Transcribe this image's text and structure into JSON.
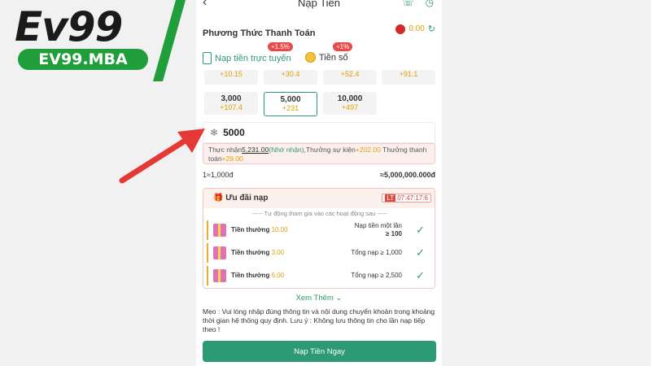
{
  "watermark": {
    "main": "Ev99",
    "sub": "EV99.MBA"
  },
  "header": {
    "title": "Nạp Tiền",
    "back_icon": "chevron-left-icon"
  },
  "payment": {
    "label": "Phương Thức Thanh Toán",
    "balance": "0.00"
  },
  "tabs": [
    {
      "label": "Nạp tiền trực tuyến",
      "badge": "+1.5%"
    },
    {
      "label": "Tiền số",
      "badge": "+1%"
    }
  ],
  "amounts": [
    {
      "value": "",
      "bonus": "+10.15"
    },
    {
      "value": "",
      "bonus": "+30.4"
    },
    {
      "value": "",
      "bonus": "+52.4"
    },
    {
      "value": "",
      "bonus": "+91.1"
    },
    {
      "value": "3,000",
      "bonus": "+107.4"
    },
    {
      "value": "5,000",
      "bonus": "+231"
    },
    {
      "value": "10,000",
      "bonus": "+497"
    }
  ],
  "input": {
    "value": "5000"
  },
  "note": {
    "p1": "Thực nhận",
    "v1": "5,231.00",
    "p2": "(Nhớ nhận)",
    "p3": ",Thưởng sự kiện",
    "v2": "+202.00",
    "p4": " Thưởng thanh toán",
    "v3": "+29.00"
  },
  "rate": {
    "left": "1≈1,000đ",
    "right": "≈5,000,000.000đ"
  },
  "promo": {
    "title": "Ưu đãi nạp",
    "countdown_tag": "LT",
    "countdown": "07:47:17:6",
    "auto_text": "----- Tự động tham gia vào các hoạt động sau -----",
    "rows": [
      {
        "name": "Tiền thưởng",
        "amount": "10.00",
        "cond1": "Nạp tiền một lần",
        "cond2": "≥ 100"
      },
      {
        "name": "Tiền thưởng",
        "amount": "3.00",
        "cond1": "Tổng nạp ≥ 1,000",
        "cond2": ""
      },
      {
        "name": "Tiền thưởng",
        "amount": "6.00",
        "cond1": "Tổng nạp ≥ 2,500",
        "cond2": ""
      }
    ]
  },
  "more_label": "Xem Thêm",
  "memo": "Mẹo : Vui lòng nhập đúng thông tin và nội dung chuyển khoản trong khoảng thời gian hệ thống quy định. Lưu ý : Không lưu thông tin cho lần nạp tiếp theo !",
  "submit_label": "Nạp Tiền Ngay",
  "colors": {
    "accent": "#2c9a73",
    "warning": "#e0a000",
    "arrow": "#e53935",
    "brand_green": "#1f9e3b"
  }
}
